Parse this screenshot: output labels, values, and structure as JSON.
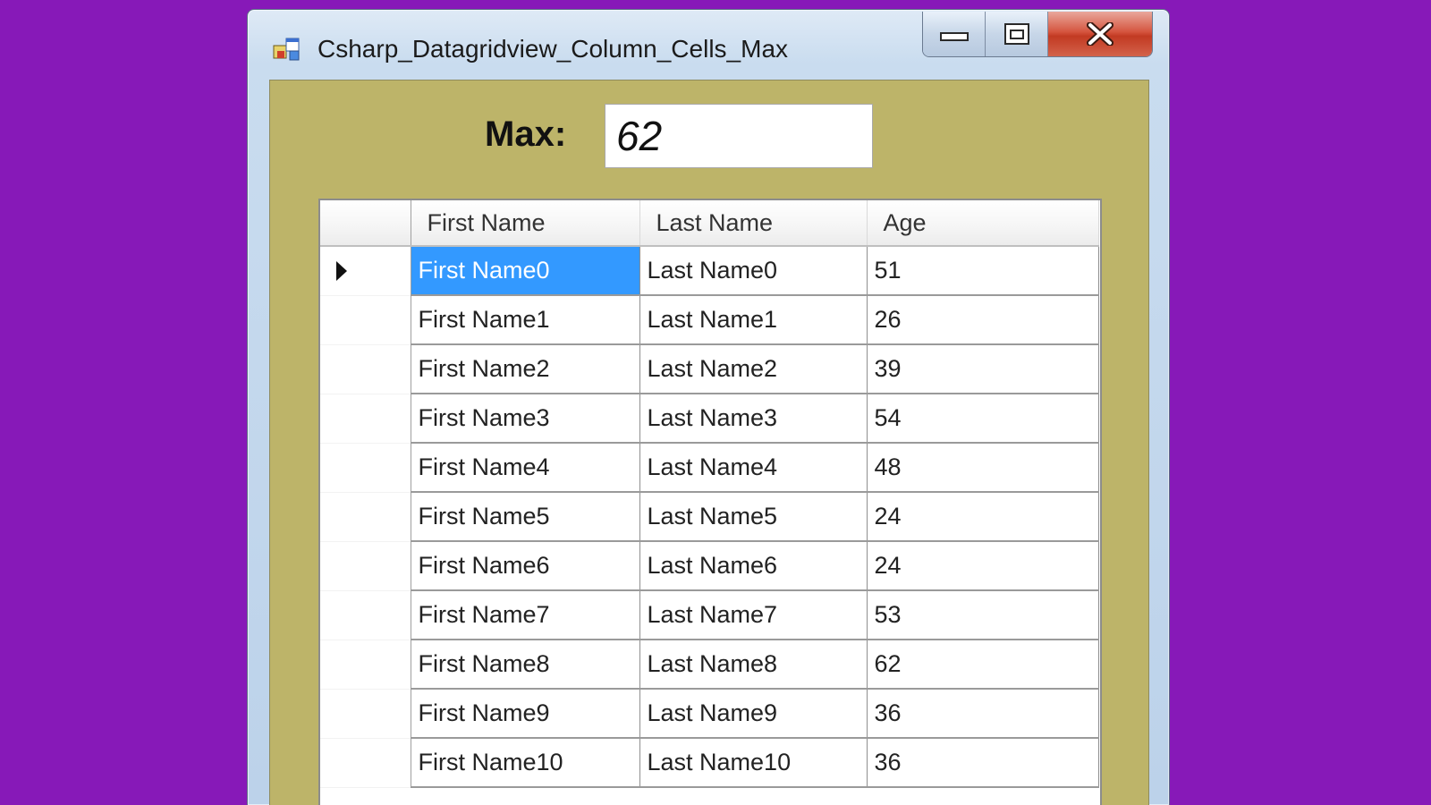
{
  "window": {
    "title": "Csharp_Datagridview_Column_Cells_Max",
    "controls": {
      "minimize_icon": "minimize-icon",
      "maximize_icon": "maximize-icon",
      "close_icon": "close-icon"
    }
  },
  "max": {
    "label": "Max:",
    "value": "62"
  },
  "grid": {
    "columns": [
      "First Name",
      "Last Name",
      "Age"
    ],
    "selected_row": 0,
    "selected_column": 0,
    "rows": [
      [
        "First Name0",
        "Last Name0",
        "51"
      ],
      [
        "First Name1",
        "Last Name1",
        "26"
      ],
      [
        "First Name2",
        "Last Name2",
        "39"
      ],
      [
        "First Name3",
        "Last Name3",
        "54"
      ],
      [
        "First Name4",
        "Last Name4",
        "48"
      ],
      [
        "First Name5",
        "Last Name5",
        "24"
      ],
      [
        "First Name6",
        "Last Name6",
        "24"
      ],
      [
        "First Name7",
        "Last Name7",
        "53"
      ],
      [
        "First Name8",
        "Last Name8",
        "62"
      ],
      [
        "First Name9",
        "Last Name9",
        "36"
      ],
      [
        "First Name10",
        "Last Name10",
        "36"
      ]
    ]
  },
  "colors": {
    "background": "#8719b8",
    "form_background": "#bdb469",
    "selection": "#3399ff",
    "close_button": "#c9432b"
  }
}
